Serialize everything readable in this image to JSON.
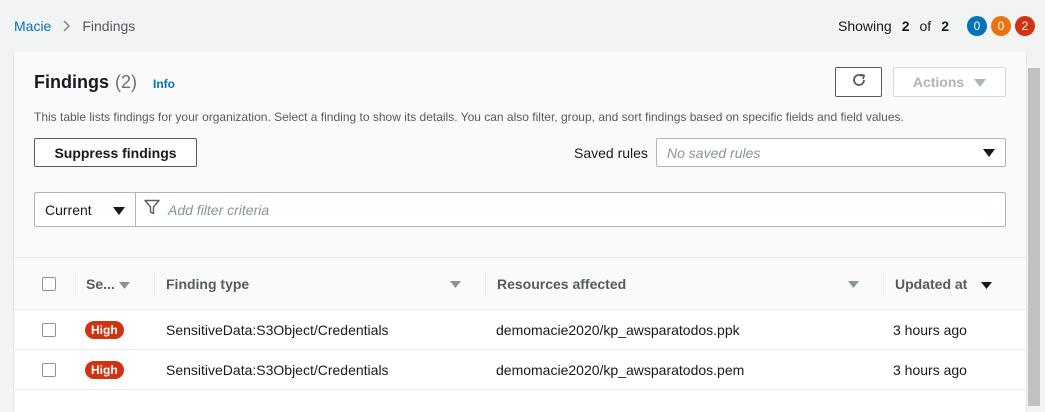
{
  "breadcrumb": {
    "root": "Macie",
    "current": "Findings"
  },
  "showing": {
    "label": "Showing",
    "shown": "2",
    "of": "of",
    "total": "2"
  },
  "count_badges": [
    {
      "value": "0",
      "color": "#0073bb"
    },
    {
      "value": "0",
      "color": "#ec7211"
    },
    {
      "value": "2",
      "color": "#d13212"
    }
  ],
  "header": {
    "title": "Findings",
    "count": "(2)",
    "info": "Info",
    "actions_label": "Actions",
    "description": "This table lists findings for your organization. Select a finding to show its details. You can also filter, group, and sort findings based on specific fields and field values.",
    "suppress_label": "Suppress findings",
    "saved_rules_label": "Saved rules",
    "saved_rules_placeholder": "No saved rules"
  },
  "filter": {
    "scope": "Current",
    "placeholder": "Add filter criteria"
  },
  "table": {
    "columns": [
      "Se...",
      "Finding type",
      "Resources affected",
      "Updated at"
    ],
    "rows": [
      {
        "severity": "High",
        "finding_type": "SensitiveData:S3Object/Credentials",
        "resource": "demomacie2020/kp_awsparatodos.ppk",
        "updated": "3 hours ago"
      },
      {
        "severity": "High",
        "finding_type": "SensitiveData:S3Object/Credentials",
        "resource": "demomacie2020/kp_awsparatodos.pem",
        "updated": "3 hours ago"
      }
    ]
  }
}
